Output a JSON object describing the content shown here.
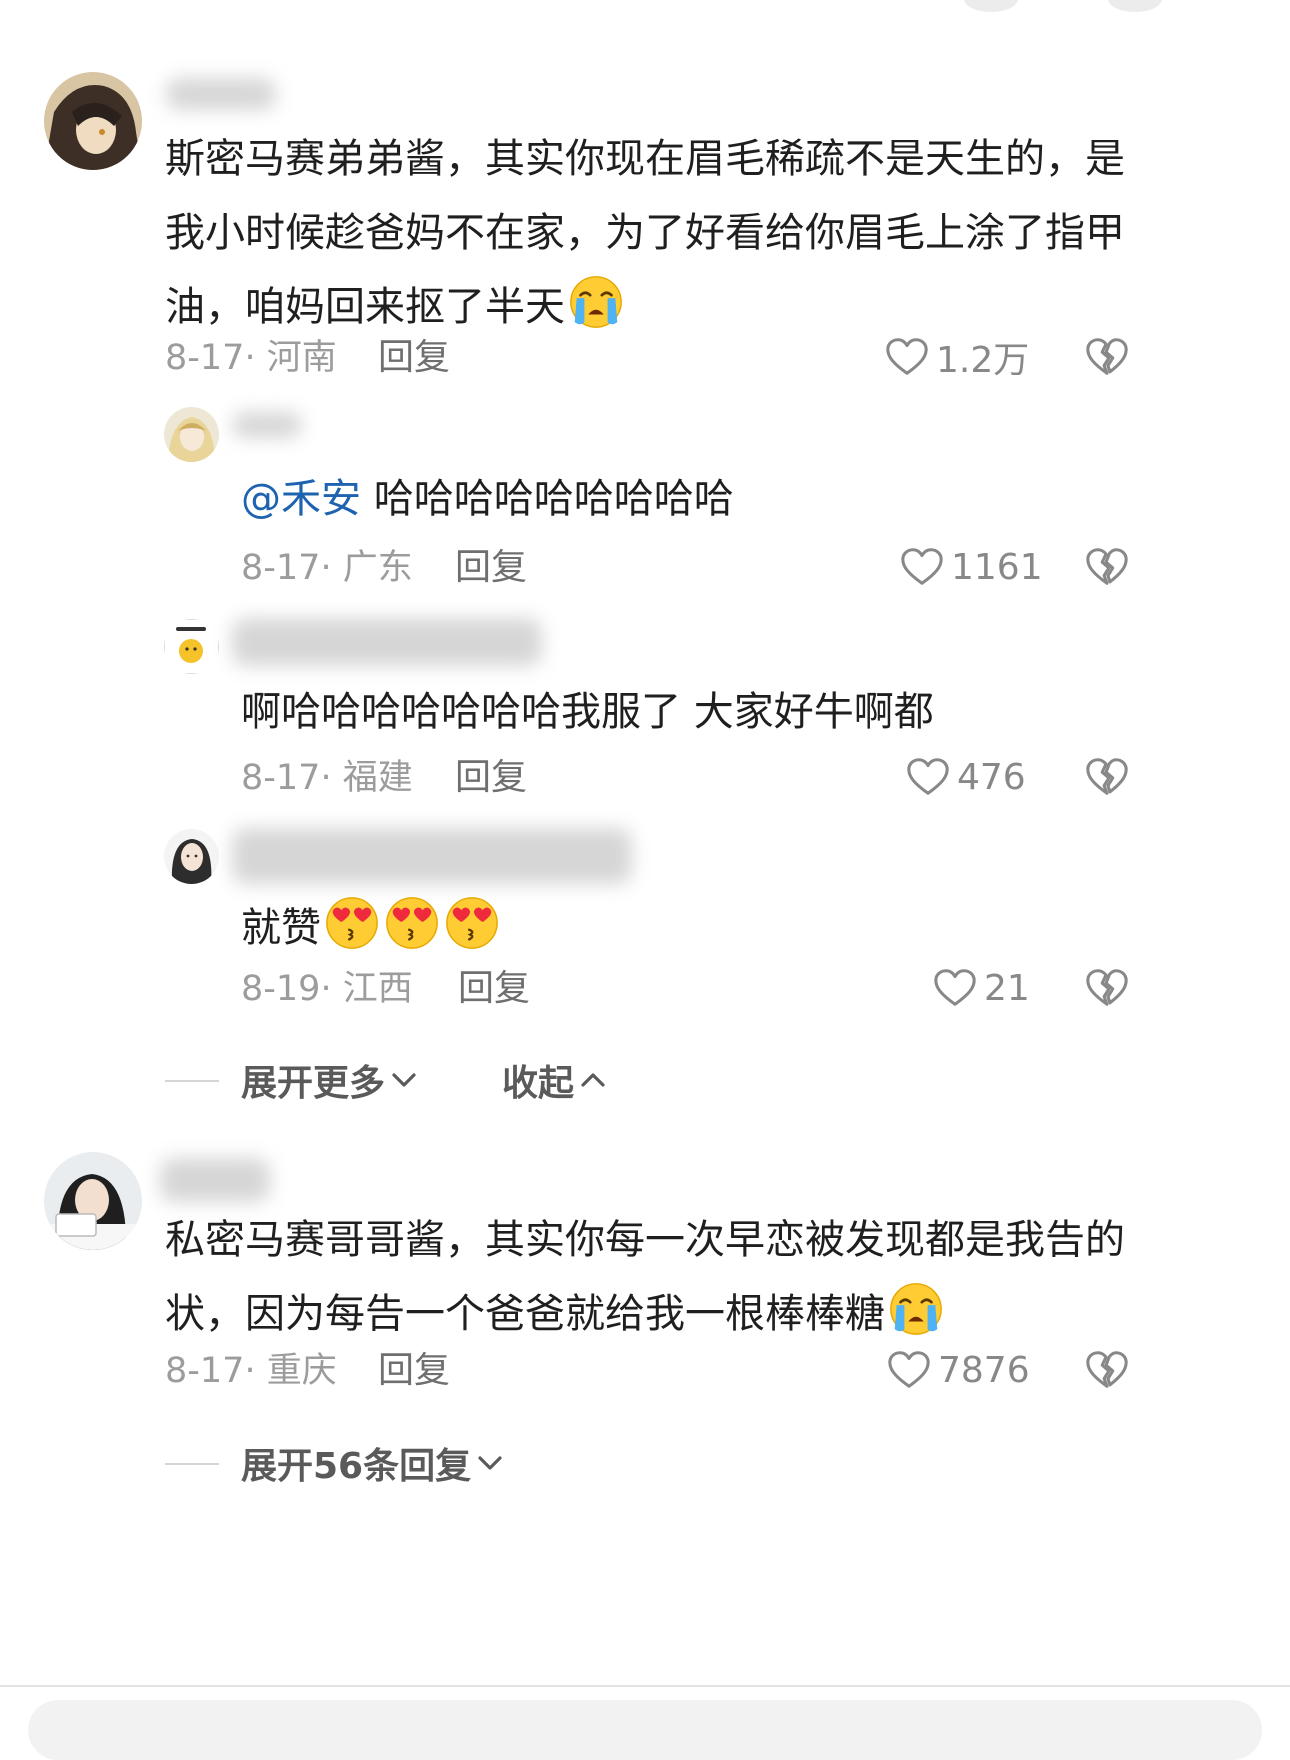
{
  "comments": [
    {
      "text": "斯密马赛弟弟酱，其实你现在眉毛稀疏不是天生的，是我小时候趁爸妈不在家，为了好看给你眉毛上涂了指甲油，咱妈回来抠了半天",
      "emoji": "loudly-crying-face",
      "date": "8-17",
      "region": "河南",
      "reply_label": "回复",
      "likes": "1.2万",
      "replies": [
        {
          "mention": "@禾安",
          "text": "哈哈哈哈哈哈哈哈哈",
          "date": "8-17",
          "region": "广东",
          "reply_label": "回复",
          "likes": "1161"
        },
        {
          "mention": "",
          "text": "啊哈哈哈哈哈哈哈我服了 大家好牛啊都",
          "date": "8-17",
          "region": "福建",
          "reply_label": "回复",
          "likes": "476"
        },
        {
          "mention": "",
          "text": "就赞",
          "emoji": "smiling-face-with-heart-eyes",
          "emoji_count": 3,
          "date": "8-19",
          "region": "江西",
          "reply_label": "回复",
          "likes": "21"
        }
      ],
      "expand_more": "展开更多",
      "collapse": "收起"
    },
    {
      "text": "私密马赛哥哥酱，其实你每一次早恋被发现都是我告的状，因为每告一个爸爸就给我一根棒棒糖",
      "emoji": "loudly-crying-face",
      "date": "8-17",
      "region": "重庆",
      "reply_label": "回复",
      "likes": "7876",
      "expand_replies": "展开56条回复"
    }
  ],
  "meta_separator": "· ",
  "colors": {
    "mention": "#1d63b0",
    "meta": "#9c9c9c",
    "text": "#1f1f1f"
  }
}
